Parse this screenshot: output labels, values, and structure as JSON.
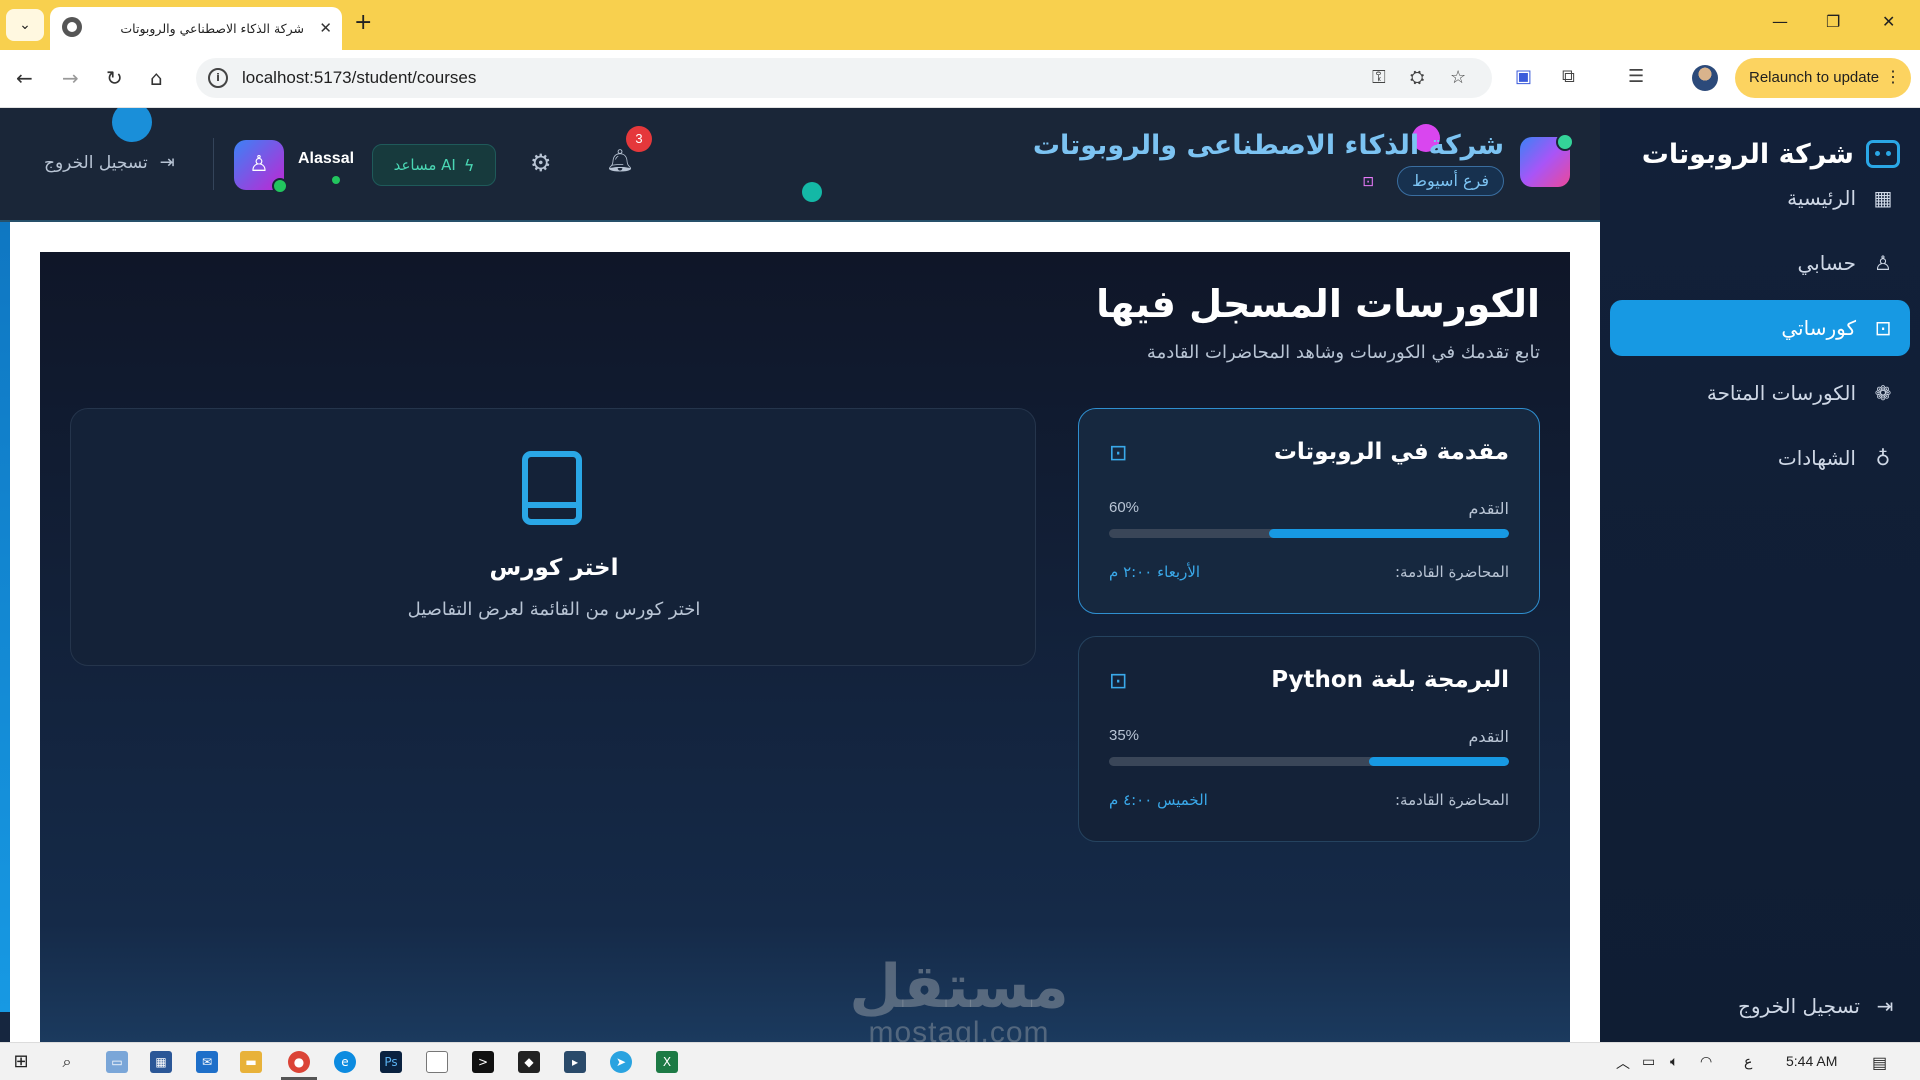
{
  "browser": {
    "tab_title": "شركة الذكاء الاصطناعي والروبوتات",
    "url": "localhost:5173/student/courses",
    "relaunch_label": "Relaunch to update"
  },
  "sidebar": {
    "brand": "شركة الروبوتات",
    "items": [
      {
        "label": "الرئيسية",
        "icon": "grid-icon",
        "active": false
      },
      {
        "label": "حسابي",
        "icon": "user-icon",
        "active": false
      },
      {
        "label": "كورساتي",
        "icon": "robot-icon",
        "active": true
      },
      {
        "label": "الكورسات المتاحة",
        "icon": "brain-icon",
        "active": false
      },
      {
        "label": "الشهادات",
        "icon": "award-icon",
        "active": false
      }
    ],
    "logout_label": "تسجيل الخروج"
  },
  "header": {
    "company_title": "شركة الذكاء الاصطناعى والروبوتات",
    "branch": "فرع أسيوط",
    "username": "Alassal",
    "ai_button_label": "AI مساعد",
    "notification_count": "3",
    "logout_label": "تسجيل الخروج"
  },
  "main": {
    "title": "الكورسات المسجل فيها",
    "subtitle": "تابع تقدمك في الكورسات وشاهد المحاضرات القادمة",
    "progress_label": "التقدم",
    "next_lecture_label": "المحاضرة القادمة:",
    "courses": [
      {
        "title": "مقدمة في الروبوتات",
        "progress_text": "60%",
        "progress": 0.6,
        "next_time": "الأربعاء ٢:٠٠ م"
      },
      {
        "title": "البرمجة بلغة Python",
        "progress_text": "35%",
        "progress": 0.35,
        "next_time": "الخميس ٤:٠٠ م"
      }
    ],
    "detail": {
      "title": "اختر كورس",
      "subtitle": "اختر كورس من القائمة لعرض التفاصيل"
    }
  },
  "watermark": {
    "arabic": "مستقل",
    "latin": "mostaql.com"
  },
  "taskbar": {
    "time": "5:44 AM",
    "lang": "ع"
  },
  "colors": {
    "accent": "#1799e3",
    "sidebar_bg": "#122039",
    "main_bg": "#0f1628",
    "badge": "#e5383b",
    "ai_green": "#4ad7b4"
  }
}
